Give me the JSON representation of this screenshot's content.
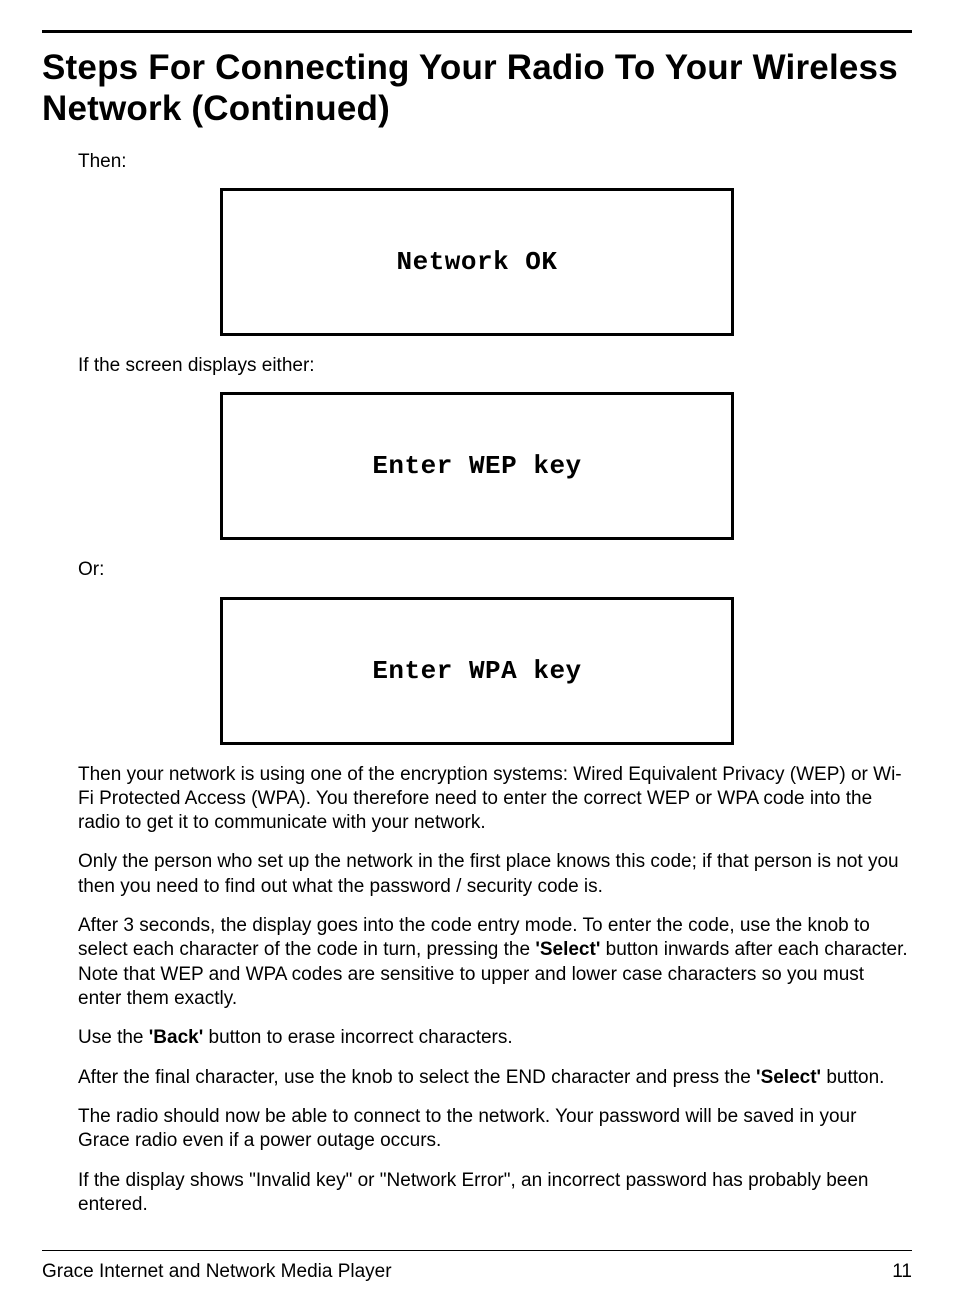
{
  "title": "Steps For Connecting Your Radio To Your Wireless Network (Continued)",
  "intro1": "Then:",
  "display1": "Network OK",
  "intro2": "If the screen displays either:",
  "display2": "Enter WEP key",
  "intro3": "Or:",
  "display3": "Enter WPA key",
  "para1": "Then your network is using one of the encryption systems:  Wired Equivalent Privacy (WEP) or Wi-Fi Protected Access (WPA). You therefore need to enter the correct WEP or WPA code into the radio to get it to communicate with your network.",
  "para2": "Only the person who set up the network in the first place knows this code; if that person is not you then you need to find out what the password / security code is.",
  "para3a": "After 3 seconds, the display goes into the code entry mode. To enter the code, use the knob to select each character of the code in turn, pressing the ",
  "para3b": "'Select'",
  "para3c": " button inwards after each character. Note that WEP and WPA codes are sensitive to upper and lower case characters so you must enter them exactly.",
  "para4a": "Use the ",
  "para4b": "'Back'",
  "para4c": " button to erase incorrect characters.",
  "para5a": "After the final character, use the knob to select the END character and press the ",
  "para5b": "'Select'",
  "para5c": " button.",
  "para6": "The radio should now be able to connect to the network. Your password will be saved in your Grace radio even if a power outage occurs.",
  "para7": "If the display shows \"Invalid key\" or \"Network Error\", an incorrect password has probably been entered.",
  "footer_left": "Grace Internet and Network Media Player",
  "footer_right": "11"
}
